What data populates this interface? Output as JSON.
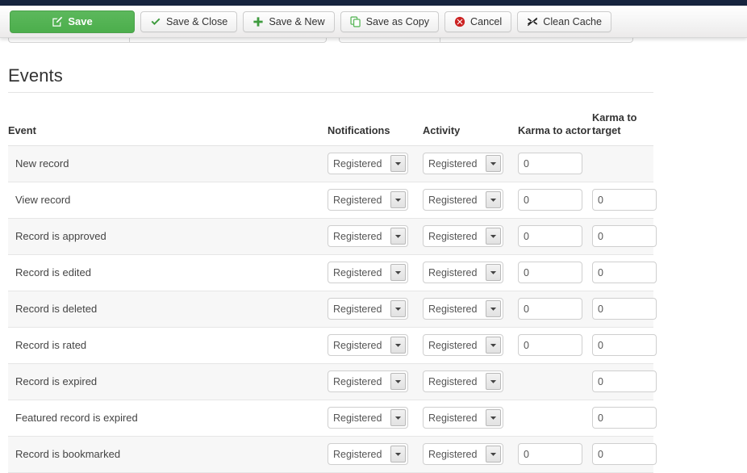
{
  "toolbar": {
    "buttons": [
      {
        "label": "Save",
        "icon": "edit-pencil-icon",
        "name": "save-button",
        "primary": true
      },
      {
        "label": "Save & Close",
        "icon": "check-icon",
        "name": "save-close-button",
        "primary": false
      },
      {
        "label": "Save & New",
        "icon": "plus-icon",
        "name": "save-new-button",
        "primary": false
      },
      {
        "label": "Save as Copy",
        "icon": "copy-icon",
        "name": "save-as-copy-button",
        "primary": false
      },
      {
        "label": "Cancel",
        "icon": "cancel-circle-icon",
        "name": "cancel-button",
        "primary": false
      },
      {
        "label": "Clean Cache",
        "icon": "clean-cache-icon",
        "name": "clean-cache-button",
        "primary": false
      }
    ]
  },
  "section": {
    "title": "Events"
  },
  "table": {
    "columns": [
      "Event",
      "Notifications",
      "Activity",
      "Karma to actor",
      "Karma to target"
    ],
    "rows": [
      {
        "event": "New record",
        "notifications": "Registered",
        "activity": "Registered",
        "karma_actor": "0",
        "karma_target": null
      },
      {
        "event": "View record",
        "notifications": "Registered",
        "activity": "Registered",
        "karma_actor": "0",
        "karma_target": "0"
      },
      {
        "event": "Record is approved",
        "notifications": "Registered",
        "activity": "Registered",
        "karma_actor": "0",
        "karma_target": "0"
      },
      {
        "event": "Record is edited",
        "notifications": "Registered",
        "activity": "Registered",
        "karma_actor": "0",
        "karma_target": "0"
      },
      {
        "event": "Record is deleted",
        "notifications": "Registered",
        "activity": "Registered",
        "karma_actor": "0",
        "karma_target": "0"
      },
      {
        "event": "Record is rated",
        "notifications": "Registered",
        "activity": "Registered",
        "karma_actor": "0",
        "karma_target": "0"
      },
      {
        "event": "Record is expired",
        "notifications": "Registered",
        "activity": "Registered",
        "karma_actor": null,
        "karma_target": "0"
      },
      {
        "event": "Featured record is expired",
        "notifications": "Registered",
        "activity": "Registered",
        "karma_actor": null,
        "karma_target": "0"
      },
      {
        "event": "Record is bookmarked",
        "notifications": "Registered",
        "activity": "Registered",
        "karma_actor": "0",
        "karma_target": "0"
      }
    ]
  },
  "colors": {
    "topbar": "#16243e",
    "primary_button": "#5cb85c",
    "cancel_icon": "#cc2222",
    "row_alt": "#f7f7f7",
    "text": "#333333"
  }
}
